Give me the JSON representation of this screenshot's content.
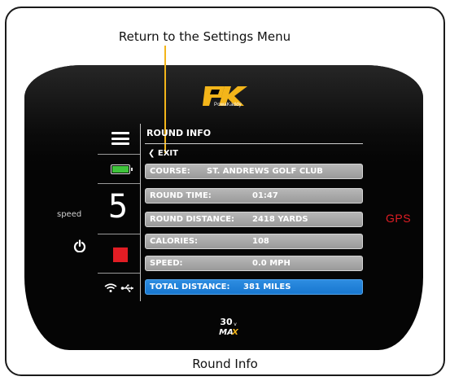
{
  "captions": {
    "top": "Return to the Settings Menu",
    "bottom": "Round Info"
  },
  "brand": {
    "logo_text": "PowaKaddy",
    "model_text": "30v MAX"
  },
  "left_panel": {
    "speed_label": "speed",
    "speed_value": "5",
    "battery_level": 1.0,
    "icons": [
      "menu-icon",
      "battery-icon",
      "power-icon",
      "stop-icon",
      "wifi-icon",
      "usb-icon"
    ]
  },
  "gps_label": "GPS",
  "screen": {
    "title": "ROUND INFO",
    "exit_label": "EXIT",
    "rows": [
      {
        "label": "COURSE:",
        "value": "ST. ANDREWS GOLF CLUB"
      },
      {
        "label": "ROUND TIME:",
        "value": "01:47"
      },
      {
        "label": "ROUND DISTANCE:",
        "value": "2418 YARDS"
      },
      {
        "label": "CALORIES:",
        "value": "108"
      },
      {
        "label": "SPEED:",
        "value": "0.0 MPH"
      },
      {
        "label": "TOTAL DISTANCE:",
        "value": "381 MILES"
      }
    ]
  },
  "colors": {
    "accent_yellow": "#f3b51a",
    "stop_red": "#e11d24",
    "selected_blue": "#1877d0",
    "battery_green": "#3fc33b"
  }
}
